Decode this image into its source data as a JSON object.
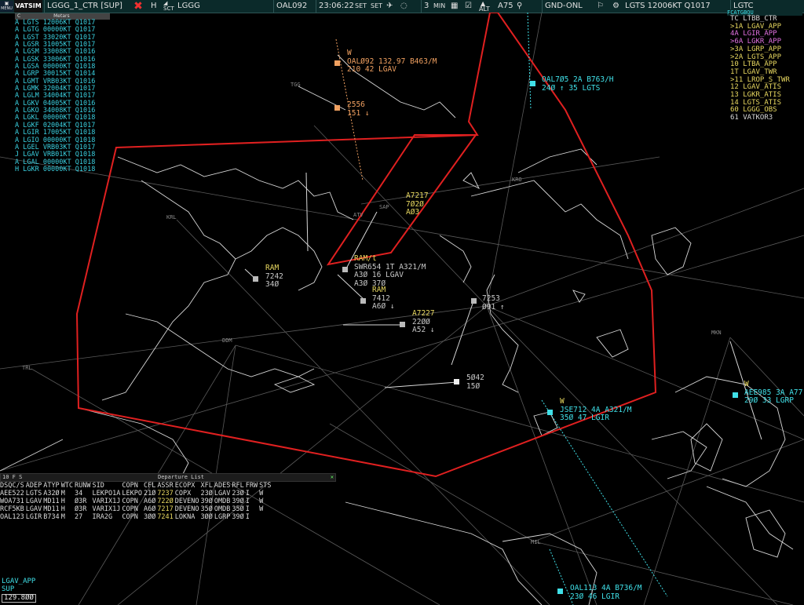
{
  "topbar": {
    "menu_label": "MENU",
    "logo": "VATSIM",
    "profile": "LGGG_1_CTR [SUP]",
    "h_label": "H",
    "sct_label": "SCT",
    "sector": "LGGG",
    "callsign": "OAL092",
    "time": "23:06:22",
    "set1": "SET",
    "set2": "SET",
    "count": "3",
    "min": "MIN",
    "alt": "ALT",
    "zoom": "A75",
    "mode": "GND-ONL",
    "metar": "LGTS 12006KT Q1017",
    "tail": "LGTC"
  },
  "metars": {
    "title": "Metars",
    "close": "C",
    "rows": [
      "A LGTS 12006KT Q1017",
      "A LGTG 00000KT Q1017",
      "A LGST 33020KT Q1017",
      "A LGSR 31005KT Q1017",
      "A LGSM 33008KT Q1016",
      "A LGSK 33006KT Q1016",
      "A LGSA 00000KT Q1018",
      "A LGRP 30015KT Q1014",
      "A LGMT VRB03KT Q1016",
      "A LGMK 32004KT Q1017",
      "A LGLM 34004KT Q1017",
      "A LGKV 04005KT Q1016",
      "A LGKO 34008KT Q1016",
      "A LGKL 00000KT Q1018",
      "A LGKF 02004KT Q1017",
      "A LGIR 17005KT Q1018",
      "A LGIO 00000KT Q1018",
      "A LGEL VRB03KT Q1017",
      "J LGAV VRB01KT Q1018",
      "A LGAL 00000KT Q1018",
      "H LGKR 00000KT Q1018"
    ]
  },
  "freqs": {
    "header": "FCATGBQU",
    "rows": [
      {
        "t": "TC LTBB_CTR",
        "c": "#d8d8d8"
      },
      {
        "t": ">1A LGAV_APP",
        "c": "#e8d860"
      },
      {
        "t": "4A LGIR_APP",
        "c": "#e070e0"
      },
      {
        "t": ">6A LGKR_APP",
        "c": "#e070e0"
      },
      {
        "t": ">3A LGRP_APP",
        "c": "#e8d860"
      },
      {
        "t": ">2A LGTS_APP",
        "c": "#e8d860"
      },
      {
        "t": "10 LTBA_APP",
        "c": "#e8d860"
      },
      {
        "t": "1T LGAV_TWR",
        "c": "#e8d860"
      },
      {
        "t": ">11 LROP_S_TWR",
        "c": "#e8d860"
      },
      {
        "t": "12 LGAV_ATIS",
        "c": "#e8d860"
      },
      {
        "t": "13 LGKR_ATIS",
        "c": "#e8d860"
      },
      {
        "t": "14 LGTS_ATIS",
        "c": "#e8d860"
      },
      {
        "t": "60 LGGG_OBS",
        "c": "#e8d860"
      },
      {
        "t": "61 VATKOR3",
        "c": "#d8d8d8"
      }
    ]
  },
  "navaids": [
    {
      "id": "TGG"
    },
    {
      "id": "KRL"
    },
    {
      "id": "ATV"
    },
    {
      "id": "KRO"
    },
    {
      "id": "DDM"
    },
    {
      "id": "TRL"
    },
    {
      "id": "SAP"
    },
    {
      "id": "MKN"
    },
    {
      "id": "MIL"
    }
  ],
  "aircraft": [
    {
      "lines": [
        "W",
        "OALØ92 132.97 B463/M",
        "210 42 LGAV"
      ],
      "cls": "o"
    },
    {
      "lines": [
        "2556",
        "151 ↓"
      ],
      "cls": "o"
    },
    {
      "lines": [
        "OAL7Ø5 2A B763/H",
        "24Ø ↑ 35 LGTS"
      ],
      "cls": "c"
    },
    {
      "lines": [
        "A7217",
        "7Ø2Ø",
        "AØ3"
      ],
      "cls": "y"
    },
    {
      "lines": [
        "RAM/t",
        "SWR654 1T A321/M",
        "A3Ø 16 LGAV",
        "A3Ø 37Ø"
      ],
      "cls": "g"
    },
    {
      "lines": [
        "RAM",
        "7242",
        "34Ø"
      ],
      "cls": "y"
    },
    {
      "lines": [
        "RAM",
        "7412",
        "A6Ø ↓"
      ],
      "cls": "y"
    },
    {
      "lines": [
        "A7227",
        "22ØØ",
        "A52 ↓"
      ],
      "cls": "y"
    },
    {
      "lines": [
        "7253",
        "Ø91 ↑"
      ],
      "cls": "g"
    },
    {
      "lines": [
        "5Ø42",
        "15Ø"
      ],
      "cls": "g"
    },
    {
      "lines": [
        "W",
        "JSE712 4A A321/M",
        "35Ø 47 LGIR"
      ],
      "cls": "c"
    },
    {
      "lines": [
        "W",
        "AEE985 3A A77",
        "29Ø 33 LGRP"
      ],
      "cls": "c"
    },
    {
      "lines": [
        "OAL113 4A B736/M",
        "23Ø 46 LGIR"
      ],
      "cls": "c"
    }
  ],
  "departures": {
    "title": "Departure List",
    "flags": "10 F S",
    "headers": [
      "DSQC/S",
      "ADEP",
      "ATYP",
      "WTC",
      "RUNW",
      "SID",
      "COPN",
      "CFL",
      "ASSR",
      "ECOPX",
      "XFL",
      "ADES",
      "RFL",
      "FRW",
      "STS"
    ],
    "rows": [
      [
        "AEE522",
        "LGTS",
        "A32Ø",
        "M",
        "34",
        "LEKPO1A",
        "LEKPO",
        "21Ø",
        "7237",
        "COPX",
        "23Ø",
        "LGAV",
        "23Ø",
        "I",
        "W"
      ],
      [
        "WOA731",
        "LGAV",
        "MD11",
        "H",
        "Ø3R",
        "VARIX1J",
        "COPN",
        "A6Ø",
        "722Ø",
        "DEVENO",
        "39Ø",
        "OMDB",
        "39Ø",
        "I",
        "W"
      ],
      [
        "RCF5KB",
        "LGAV",
        "MD11",
        "H",
        "Ø3R",
        "VARIX1J",
        "COPN",
        "A6Ø",
        "7217",
        "DEVENO",
        "35Ø",
        "OMDB",
        "35Ø",
        "I",
        "W"
      ],
      [
        "OAL123",
        "LGIR",
        "B734",
        "M",
        "27",
        "IRA2G",
        "COPN",
        "3ØØ",
        "7241",
        "LOKNA",
        "3ØØ",
        "LGRP",
        "39Ø",
        "I",
        ""
      ]
    ]
  },
  "status": {
    "station": "LGAV_APP",
    "role": "SUP",
    "frequency": "129.8ØØ"
  },
  "colors": {
    "sector": "#e02020",
    "accent": "#40e0e8",
    "label": "#e8d860"
  }
}
